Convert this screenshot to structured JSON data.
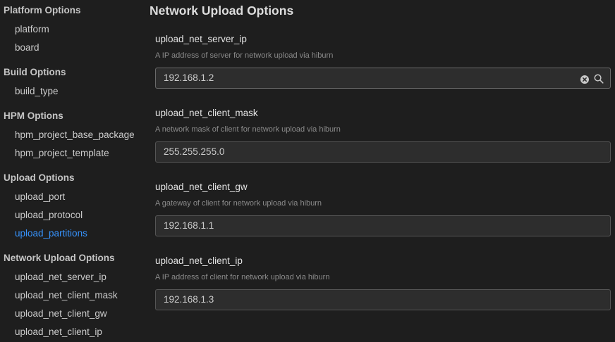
{
  "sidebar": {
    "groups": [
      {
        "title": "Platform Options",
        "items": [
          "platform",
          "board"
        ]
      },
      {
        "title": "Build Options",
        "items": [
          "build_type"
        ]
      },
      {
        "title": "HPM Options",
        "items": [
          "hpm_project_base_package",
          "hpm_project_template"
        ]
      },
      {
        "title": "Upload Options",
        "items": [
          "upload_port",
          "upload_protocol",
          "upload_partitions"
        ]
      },
      {
        "title": "Network Upload Options",
        "items": [
          "upload_net_server_ip",
          "upload_net_client_mask",
          "upload_net_client_gw",
          "upload_net_client_ip"
        ]
      }
    ],
    "active_item": "upload_partitions"
  },
  "main": {
    "section_title": "Network Upload Options",
    "settings": [
      {
        "label": "upload_net_server_ip",
        "description": "A IP address of server for network upload via hiburn",
        "value": "192.168.1.2"
      },
      {
        "label": "upload_net_client_mask",
        "description": "A network mask of client for network upload via hiburn",
        "value": "255.255.255.0"
      },
      {
        "label": "upload_net_client_gw",
        "description": "A gateway of client for network upload via hiburn",
        "value": "192.168.1.1"
      },
      {
        "label": "upload_net_client_ip",
        "description": "A IP address of client for network upload via hiburn",
        "value": "192.168.1.3"
      }
    ]
  },
  "icons": {
    "clear": "clear-circle-icon",
    "search": "search-icon"
  },
  "colors": {
    "background": "#1e1e1e",
    "active_link": "#3794ff",
    "input_background": "#2d2d2d",
    "input_border": "#555555"
  }
}
